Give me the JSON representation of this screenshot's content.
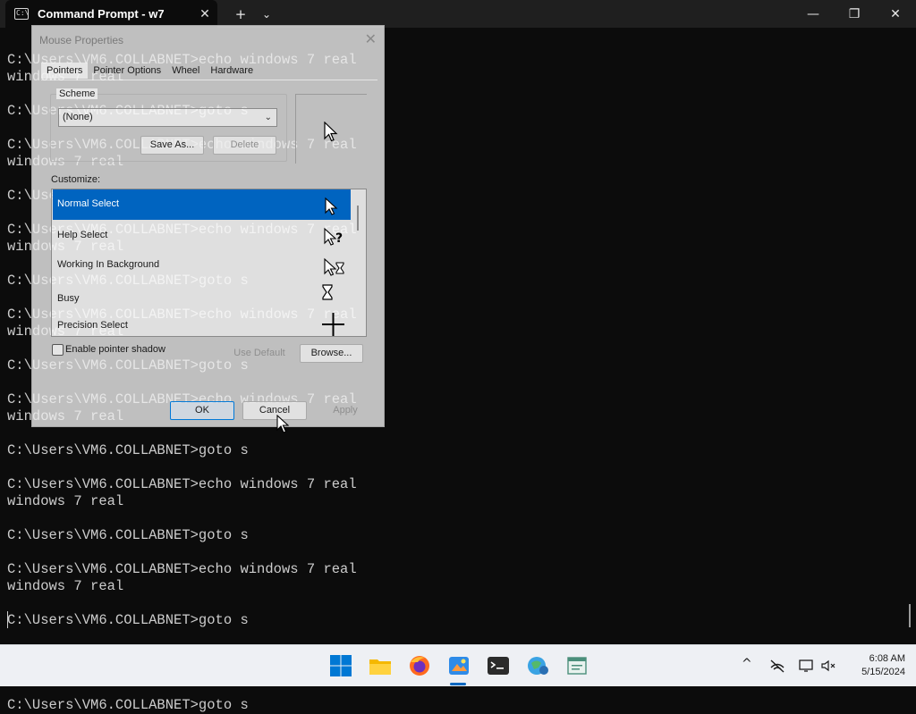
{
  "window": {
    "tab_title": "Command Prompt - w7",
    "tab_icon": "terminal-icon",
    "new_tab_symbol": "+",
    "dropdown_symbol": "⌄",
    "close_tab_symbol": "✕",
    "minimize_symbol": "—",
    "maximize_symbol": "❐",
    "close_symbol": "✕"
  },
  "terminal": {
    "lines": [
      "C:\\Users\\VM6.COLLABNET>echo windows 7 real",
      "windows 7 real",
      "",
      "C:\\Users\\VM6.COLLABNET>goto s",
      "",
      "C:\\Users\\VM6.COLLABNET>echo windows 7 real",
      "windows 7 real",
      "",
      "C:\\Users\\VM6.COLLABNET>goto s",
      "",
      "C:\\Users\\VM6.COLLABNET>echo windows 7 real",
      "windows 7 real",
      "",
      "C:\\Users\\VM6.COLLABNET>goto s",
      "",
      "C:\\Users\\VM6.COLLABNET>echo windows 7 real",
      "windows 7 real",
      "",
      "C:\\Users\\VM6.COLLABNET>goto s",
      "",
      "C:\\Users\\VM6.COLLABNET>echo windows 7 real",
      "windows 7 real",
      "",
      "C:\\Users\\VM6.COLLABNET>goto s",
      "",
      "C:\\Users\\VM6.COLLABNET>echo windows 7 real",
      "windows 7 real",
      "",
      "C:\\Users\\VM6.COLLABNET>goto s",
      "",
      "C:\\Users\\VM6.COLLABNET>echo windows 7 real",
      "windows 7 real",
      "",
      "C:\\Users\\VM6.COLLABNET>goto s",
      "",
      "C:\\Users\\VM6.COLLABNET>echo windows 7 real",
      "windows 7 real",
      "",
      "C:\\Users\\VM6.COLLABNET>goto s"
    ],
    "text_color": "#cccccc",
    "background": "#0c0c0c"
  },
  "dialog": {
    "title": "Mouse Properties",
    "tabs": [
      "Pointers",
      "Pointer Options",
      "Wheel",
      "Hardware"
    ],
    "active_tab": "Pointers",
    "scheme_label": "Scheme",
    "scheme_value": "(None)",
    "save_as_label": "Save As...",
    "delete_label": "Delete",
    "customize_label": "Customize:",
    "cursors": [
      {
        "label": "Normal Select",
        "icon": "arrow-pointer-icon",
        "selected": true
      },
      {
        "label": "Help Select",
        "icon": "help-pointer-icon",
        "selected": false
      },
      {
        "label": "Working In Background",
        "icon": "working-pointer-icon",
        "selected": false
      },
      {
        "label": "Busy",
        "icon": "hourglass-icon",
        "selected": false
      },
      {
        "label": "Precision Select",
        "icon": "crosshair-icon",
        "selected": false
      }
    ],
    "shadow_label": "Enable pointer shadow",
    "shadow_checked": false,
    "use_default_label": "Use Default",
    "browse_label": "Browse...",
    "ok_label": "OK",
    "cancel_label": "Cancel",
    "apply_label": "Apply"
  },
  "taskbar": {
    "apps": [
      "windows-start-icon",
      "file-explorer-icon",
      "firefox-icon",
      "photos-icon",
      "terminal-icon",
      "vm-app-icon",
      "notepad-icon"
    ],
    "active_app": "terminal-icon",
    "tray": [
      "chevron-up-icon",
      "network-off-icon",
      "display-icon",
      "volume-muted-icon"
    ],
    "time": "6:08 AM",
    "date": "5/15/2024"
  }
}
